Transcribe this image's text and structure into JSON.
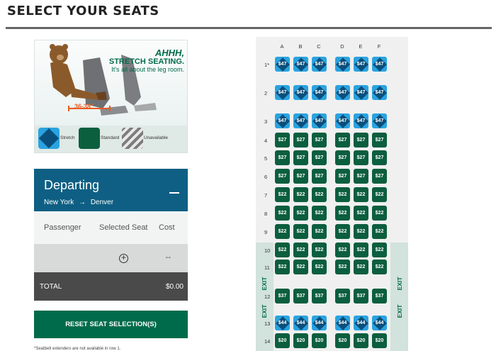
{
  "page_title": "SELECT YOUR SEATS",
  "promo": {
    "headline": "AHHH,",
    "subhead": "STRETCH SEATING.",
    "tagline": "It's all about the leg room.",
    "legroom": "36-38\"",
    "legend": [
      {
        "label": "Stretch",
        "icon": "stretch-seat-icon"
      },
      {
        "label": "Standard",
        "icon": "standard-seat-icon"
      },
      {
        "label": "Unavailable",
        "icon": "unavailable-seat-icon"
      }
    ]
  },
  "departing": {
    "title": "Departing",
    "origin": "New York",
    "destination": "Denver",
    "columns": [
      "Passenger",
      "Selected Seat",
      "Cost"
    ],
    "row_cost": "--",
    "total_label": "TOTAL",
    "total_value": "$0.00"
  },
  "reset_button": "RESET SEAT SELECTION(S)",
  "footnote": "*Seatbelt extenders are not available in row 1.",
  "seatmap": {
    "columns": [
      "A",
      "B",
      "C",
      "D",
      "E",
      "F"
    ],
    "exit_label": "EXIT",
    "rows": [
      {
        "num": "1*",
        "type": "stretch",
        "price": "$47"
      },
      {
        "num": "2",
        "type": "stretch",
        "price": "$47"
      },
      {
        "num": "3",
        "type": "stretch",
        "price": "$47"
      },
      {
        "num": "4",
        "type": "standard",
        "price": "$27"
      },
      {
        "num": "5",
        "type": "standard",
        "price": "$27"
      },
      {
        "num": "6",
        "type": "standard",
        "price": "$27"
      },
      {
        "num": "7",
        "type": "standard",
        "price": "$22"
      },
      {
        "num": "8",
        "type": "standard",
        "price": "$22"
      },
      {
        "num": "9",
        "type": "standard",
        "price": "$22"
      },
      {
        "num": "10",
        "type": "standard",
        "price": "$22"
      },
      {
        "num": "11",
        "type": "standard",
        "price": "$22"
      },
      {
        "num": "12",
        "type": "standard",
        "price": "$37"
      },
      {
        "num": "13",
        "type": "stretch",
        "price": "$44"
      },
      {
        "num": "14",
        "type": "standard",
        "price": "$20"
      }
    ]
  },
  "colors": {
    "stretch": "#29a3e0",
    "stretch_inner": "#0a4f7c",
    "standard": "#0b5e3e",
    "header_blue": "#0e5f83",
    "brand_green": "#006b4a"
  }
}
